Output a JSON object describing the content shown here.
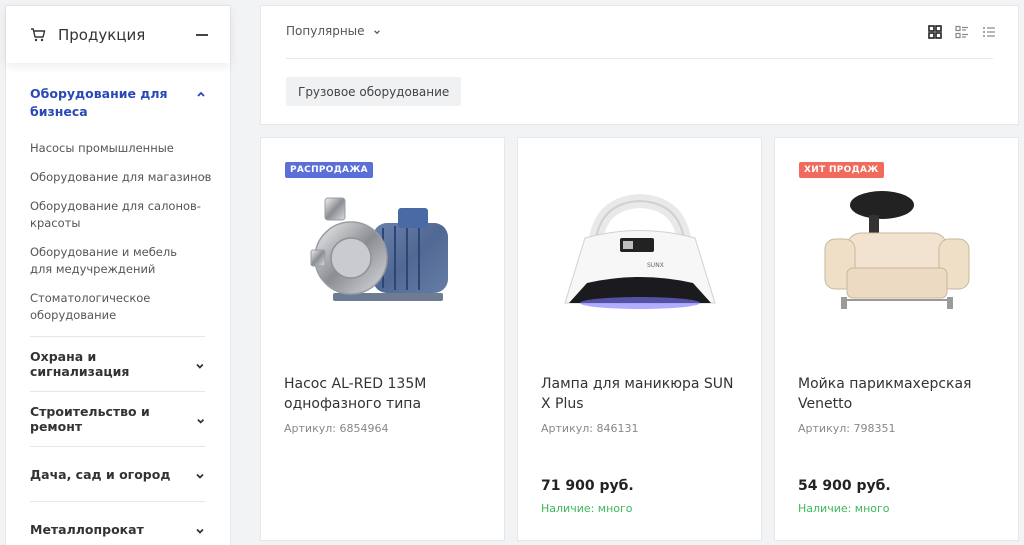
{
  "sidebar": {
    "title": "Продукция",
    "active_category": "Оборудование для бизнеса",
    "subcategories": [
      {
        "label": "Насосы промышленные"
      },
      {
        "label": "Оборудование для магазинов",
        "has_children": true
      },
      {
        "label": "Оборудование для салонов-красоты"
      },
      {
        "label": "Оборудование и мебель для медучреждений"
      },
      {
        "label": "Стоматологическое оборудование"
      }
    ],
    "categories": [
      {
        "label": "Охрана и сигнализация"
      },
      {
        "label": "Строительство и ремонт"
      },
      {
        "label": "Дача, сад и огород"
      },
      {
        "label": "Металлопрокат"
      }
    ]
  },
  "toolbar": {
    "sort_label": "Популярные",
    "filter_chip": "Грузовое оборудование"
  },
  "products": [
    {
      "badge": "РАСПРОДАЖА",
      "badge_color": "#5b6fd6",
      "title": "Насос AL-RED 135M однофазного типа",
      "sku": "Артикул: 6854964",
      "price": "",
      "stock": ""
    },
    {
      "badge": "",
      "badge_color": "",
      "title": "Лампа для маникюра SUN X Plus",
      "sku": "Артикул: 846131",
      "price": "71 900 руб.",
      "stock": "Наличие: много"
    },
    {
      "badge": "ХИТ ПРОДАЖ",
      "badge_color": "#ef6b5b",
      "title": "Мойка парикмахерская Venetto",
      "sku": "Артикул: 798351",
      "price": "54 900 руб.",
      "stock": "Наличие: много"
    }
  ],
  "colors": {
    "accent": "#2b49b6",
    "in_stock": "#3cb95c"
  }
}
